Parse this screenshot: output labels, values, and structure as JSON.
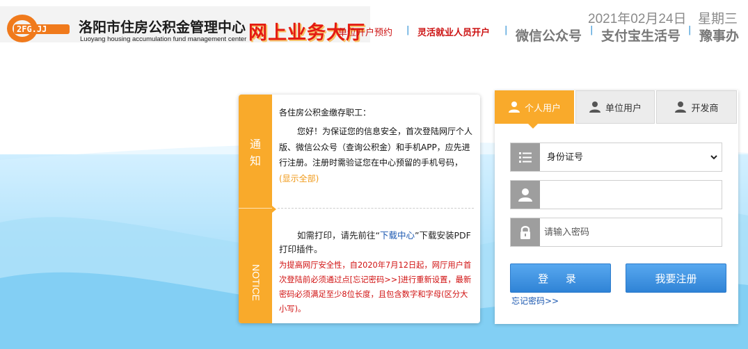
{
  "header": {
    "logo_cn": "洛阳市住房公积金管理中心",
    "logo_en": "Luoyang housing accumulation fund management center",
    "slogan": "网上业务大厅",
    "date": "2021年02月24日",
    "weekday": "星期三",
    "nav": [
      {
        "label": "单位开户预约"
      },
      {
        "label": "灵活就业人员开户"
      },
      {
        "label": "微信公众号"
      },
      {
        "label": "支付宝生活号"
      },
      {
        "label": "豫事办"
      }
    ]
  },
  "notice": {
    "strip_cn": "通知",
    "strip_en": "NOTICE",
    "greeting": "各住房公积金缴存职工：",
    "paragraph1": "您好！为保证您的信息安全，首次登陆网厅个人版、微信公众号（查询公积金）和手机APP，应先进行注册。注册时需验证您在中心预留的手机号码，",
    "show_all": "(显示全部)",
    "paragraph2_before": "如需打印，请先前往“",
    "paragraph2_link": "下载中心",
    "paragraph2_after": "”下载安装PDF打印插件。",
    "paragraph3": "为提高网厅安全性，自2020年7月12日起，网厅用户首次登陆前必须通过点[忘记密码>>]进行重新设置，最新密码必须满足至少8位长度，且包含数字和字母(区分大小写)。"
  },
  "login": {
    "tabs": [
      {
        "label": "个人用户"
      },
      {
        "label": "单位用户"
      },
      {
        "label": "开发商"
      }
    ],
    "id_type_selected": "身份证号",
    "username_value": "",
    "password_placeholder": "请输入密码",
    "login_button": "登 录",
    "register_button": "我要注册",
    "forgot_link": "忘记密码>>"
  },
  "colors": {
    "accent_orange": "#f9aa2b",
    "button_blue": "#3a8fe0",
    "alert_red": "#d01010",
    "link_blue": "#1a57b0"
  }
}
